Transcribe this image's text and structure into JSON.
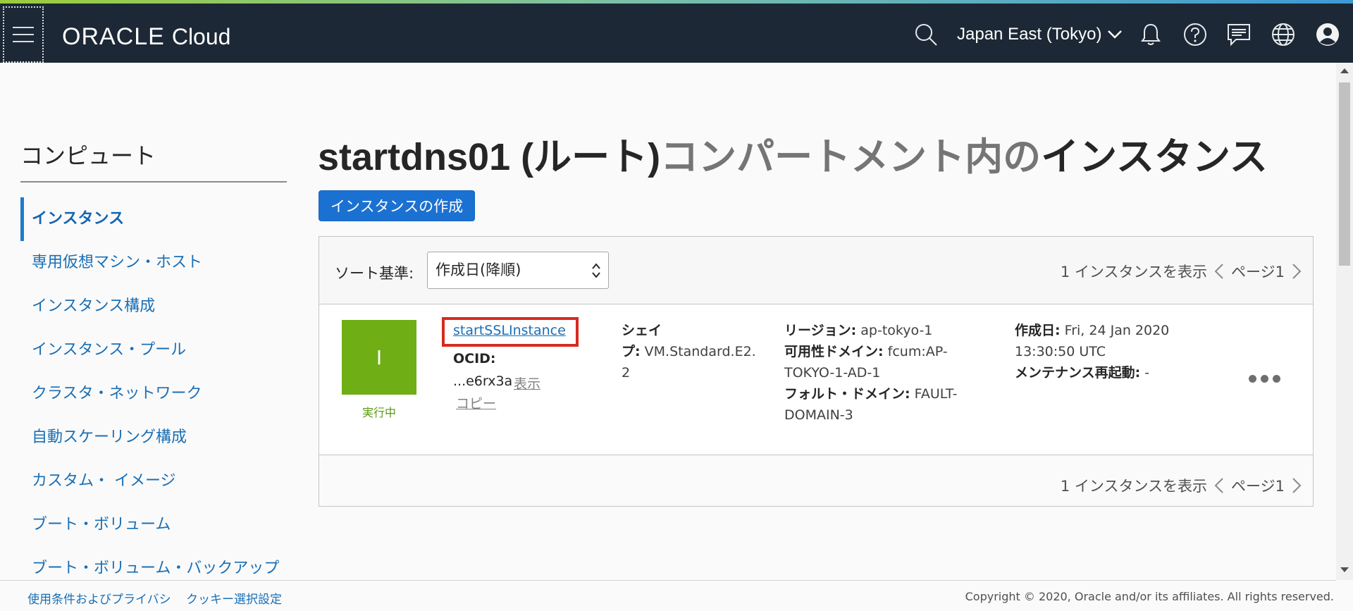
{
  "header": {
    "logo_oracle": "ORACLE",
    "logo_cloud": "Cloud",
    "region": "Japan East (Tokyo)"
  },
  "sidebar": {
    "title": "コンピュート",
    "items": [
      {
        "label": "インスタンス",
        "active": true
      },
      {
        "label": "専用仮想マシン・ホスト"
      },
      {
        "label": "インスタンス構成"
      },
      {
        "label": "インスタンス・プール"
      },
      {
        "label": "クラスタ・ネットワーク"
      },
      {
        "label": "自動スケーリング構成"
      },
      {
        "label": "カスタム・ イメージ"
      },
      {
        "label": "ブート・ボリューム"
      },
      {
        "label": "ブート・ボリューム・バックアップ"
      }
    ]
  },
  "main": {
    "title_compartment": "startdns01 (ルート)",
    "title_middle": "コンパートメント内の",
    "title_end": "インスタンス",
    "create_button": "インスタンスの作成",
    "sort_label": "ソート基準:",
    "sort_value": "作成日(降順)",
    "pager_text": "1 インスタンスを表示",
    "pager_page": "ページ1",
    "instance": {
      "icon_letter": "I",
      "status": "実行中",
      "name": "startSSLInstance",
      "ocid_label": "OCID:",
      "ocid_value": "...e6rx3a",
      "ocid_show": "表示",
      "ocid_copy": "コピー",
      "shape_label_1": "シェイ",
      "shape_label_2": "プ:",
      "shape_value_1": "VM.Standard.E2.",
      "shape_value_2": "2",
      "region_label": "リージョン:",
      "region_value": "ap-tokyo-1",
      "ad_label": "可用性ドメイン:",
      "ad_value_1": "fcum:AP-",
      "ad_value_2": "TOKYO-1-AD-1",
      "fd_label": "フォルト・ドメイン:",
      "fd_value_1": "FAULT-",
      "fd_value_2": "DOMAIN-3",
      "created_label": "作成日:",
      "created_value_1": "Fri, 24 Jan 2020",
      "created_value_2": "13:30:50 UTC",
      "maint_label": "メンテナンス再起動:",
      "maint_value": "-"
    }
  },
  "footer": {
    "terms": "使用条件およびプライバシ",
    "cookies": "クッキー選択設定",
    "copyright": "Copyright © 2020, Oracle and/or its affiliates. All rights reserved."
  },
  "colors": {
    "header_bg": "#1c2835",
    "accent_blue": "#1b71d1",
    "running_green": "#6fae14",
    "highlight_red": "#d62b1f"
  }
}
